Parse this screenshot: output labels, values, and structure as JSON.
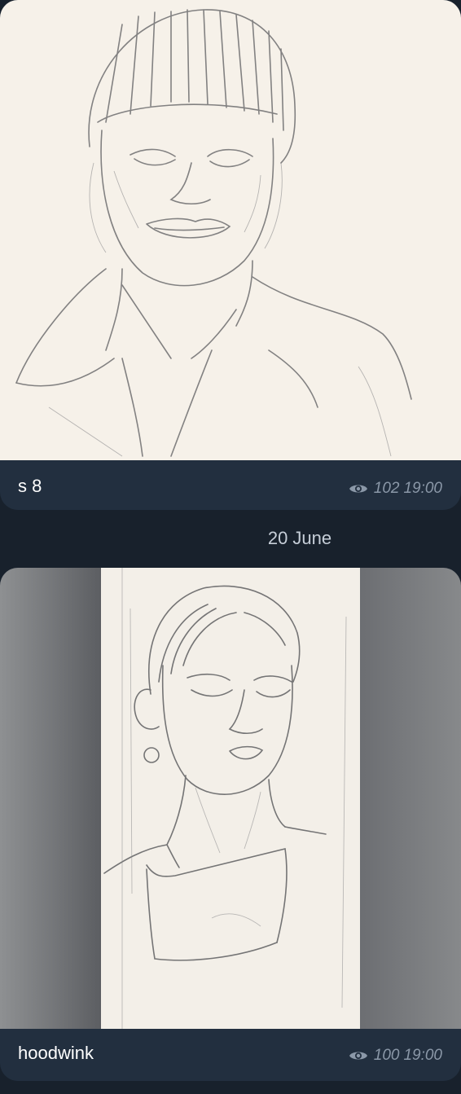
{
  "messages": [
    {
      "caption": "s 8",
      "views": "102",
      "time": "19:00",
      "icon": "eye-icon"
    },
    {
      "caption": "hoodwink",
      "views": "100",
      "time": "19:00",
      "icon": "eye-icon"
    }
  ],
  "date_separator": "20 June",
  "colors": {
    "background": "#18212c",
    "bubble": "#222f3f",
    "caption_text": "#ffffff",
    "meta_text": "#8b98a8",
    "paper": "#f6f1e9"
  }
}
